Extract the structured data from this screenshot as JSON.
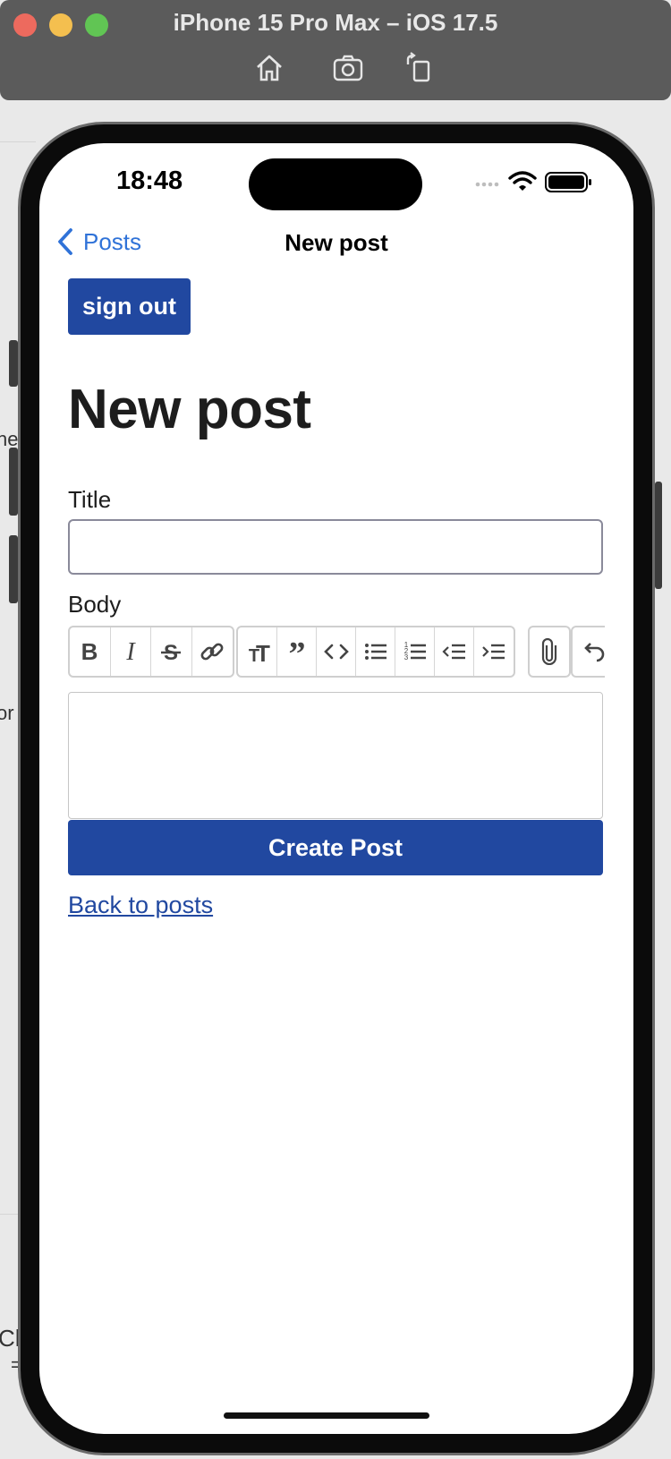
{
  "simulator": {
    "title": "iPhone 15 Pro Max – iOS 17.5",
    "tools": [
      "home-icon",
      "screenshot-icon",
      "rotate-icon"
    ]
  },
  "status_bar": {
    "time": "18:48"
  },
  "navbar": {
    "back_label": "Posts",
    "title": "New post"
  },
  "page": {
    "sign_out": "sign out",
    "heading": "New post",
    "title_label": "Title",
    "title_value": "",
    "body_label": "Body",
    "body_value": "",
    "submit": "Create Post",
    "back_link": "Back to posts"
  },
  "toolbar_buttons": [
    "bold-icon",
    "italic-icon",
    "strikethrough-icon",
    "link-icon",
    "heading-icon",
    "quote-icon",
    "code-icon",
    "bullet-list-icon",
    "numbered-list-icon",
    "outdent-icon",
    "indent-icon",
    "attach-icon",
    "undo-icon"
  ],
  "backdrop": {
    "fragments": [
      "ne",
      "or",
      "Ch",
      "="
    ]
  },
  "colors": {
    "primary": "#2148a0",
    "ios_link": "#2f72d8",
    "sim_bar": "#5b5b5b"
  }
}
